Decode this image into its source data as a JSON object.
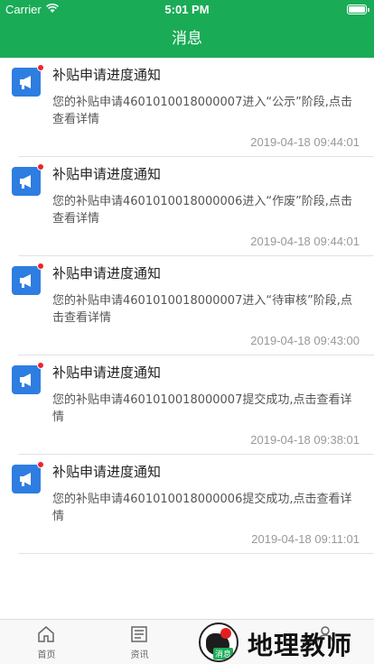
{
  "status_bar": {
    "carrier": "Carrier",
    "time": "5:01 PM"
  },
  "header": {
    "title": "消息"
  },
  "messages": [
    {
      "title": "补贴申请进度通知",
      "body": "您的补贴申请4601010018000007进入“公示”阶段,点击查看详情",
      "time": "2019-04-18 09:44:01"
    },
    {
      "title": "补贴申请进度通知",
      "body": "您的补贴申请4601010018000006进入“作废”阶段,点击查看详情",
      "time": "2019-04-18 09:44:01"
    },
    {
      "title": "补贴申请进度通知",
      "body": "您的补贴申请4601010018000007进入“待审核”阶段,点击查看详情",
      "time": "2019-04-18 09:43:00"
    },
    {
      "title": "补贴申请进度通知",
      "body": "您的补贴申请4601010018000007提交成功,点击查看详情",
      "time": "2019-04-18 09:38:01"
    },
    {
      "title": "补贴申请进度通知",
      "body": "您的补贴申请4601010018000006提交成功,点击查看详情",
      "time": "2019-04-18 09:11:01"
    }
  ],
  "tabbar": {
    "home": "首页",
    "news": "资讯",
    "messages": "消息"
  },
  "watermark": {
    "text": "地理教师",
    "badge": "消息"
  },
  "colors": {
    "brand_green": "#1aab57",
    "icon_blue": "#2e7de1",
    "unread_red": "#f0232a"
  }
}
